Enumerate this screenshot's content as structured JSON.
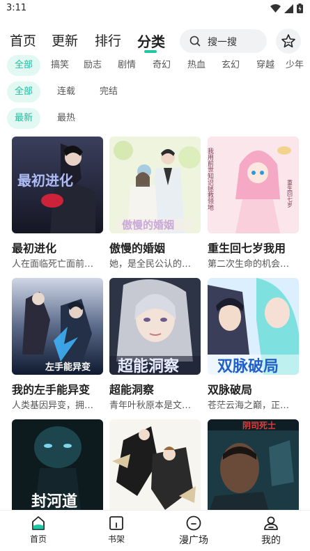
{
  "status": {
    "time": "3:11"
  },
  "nav": {
    "tabs": [
      {
        "label": "首页"
      },
      {
        "label": "更新"
      },
      {
        "label": "排行"
      },
      {
        "label": "分类",
        "active": true
      }
    ]
  },
  "search": {
    "placeholder": "搜一搜"
  },
  "filters": {
    "genre": [
      "全部",
      "搞笑",
      "励志",
      "剧情",
      "奇幻",
      "热血",
      "玄幻",
      "穿越",
      "少年"
    ],
    "status": [
      "全部",
      "连载",
      "完结"
    ],
    "sort": [
      "最新",
      "最热"
    ]
  },
  "comics": [
    {
      "title": "最初进化",
      "desc": "人在面临死亡面前…"
    },
    {
      "title": "傲慢的婚姻",
      "desc": "她，是全民公认的…"
    },
    {
      "title": "重生回七岁我用",
      "desc": "第二次生命的机会…"
    },
    {
      "title": "我的左手能异变",
      "desc": "人类基因异变，拥…"
    },
    {
      "title": "超能洞察",
      "desc": "青年叶秋原本是文…"
    },
    {
      "title": "双脉破局",
      "desc": "苍茫云海之巅，正…"
    },
    {
      "title": "",
      "desc": ""
    },
    {
      "title": "",
      "desc": ""
    },
    {
      "title": "",
      "desc": ""
    }
  ],
  "cover_text": {
    "c1": "最初进化",
    "c2": "傲慢的婚姻",
    "c3": "我用前世知识拯救领地",
    "c3b": "重生回七岁",
    "c4": "左手能异变",
    "c5": "超能洞察",
    "c6": "双脉破局",
    "c7": "封河道",
    "c9": "阴司死士"
  },
  "bottom_nav": [
    {
      "label": "首页"
    },
    {
      "label": "书架"
    },
    {
      "label": "漫广场"
    },
    {
      "label": "我的"
    }
  ],
  "colors": {
    "accent": "#1dc8a6",
    "chip_bg": "#e2f8f3"
  }
}
